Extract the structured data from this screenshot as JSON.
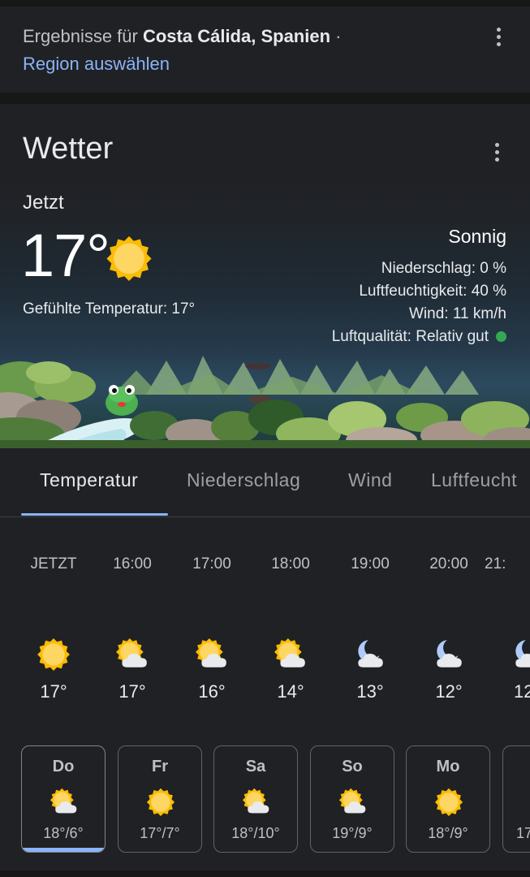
{
  "region": {
    "prefix": "Ergebnisse für ",
    "place": "Costa Cálida, Spanien",
    "suffix": " ·",
    "link": "Region auswählen"
  },
  "weather": {
    "title": "Wetter",
    "now_label": "Jetzt",
    "temperature": "17°",
    "condition": "Sonnig",
    "feels_like": "Gefühlte Temperatur: 17°",
    "precipitation": "Niederschlag: 0 %",
    "humidity": "Luftfeuchtigkeit: 40 %",
    "wind": "Wind: 11 km/h",
    "air_quality": "Luftqualität: Relativ gut",
    "air_quality_color": "#34a853"
  },
  "tabs": [
    "Temperatur",
    "Niederschlag",
    "Wind",
    "Luftfeucht"
  ],
  "hourly": [
    {
      "time": "JETZT",
      "temp": "17°",
      "icon": "sun-icon"
    },
    {
      "time": "16:00",
      "temp": "17°",
      "icon": "sun-cloud-icon"
    },
    {
      "time": "17:00",
      "temp": "16°",
      "icon": "sun-cloud-icon"
    },
    {
      "time": "18:00",
      "temp": "14°",
      "icon": "sun-cloud-icon"
    },
    {
      "time": "19:00",
      "temp": "13°",
      "icon": "moon-cloud-icon"
    },
    {
      "time": "20:00",
      "temp": "12°",
      "icon": "moon-cloud-icon"
    },
    {
      "time": "21:",
      "temp": "12",
      "icon": "moon-cloud-icon"
    }
  ],
  "daily": [
    {
      "day": "Do",
      "temps": "18°/6°",
      "icon": "sun-cloud-icon"
    },
    {
      "day": "Fr",
      "temps": "17°/7°",
      "icon": "sun-icon"
    },
    {
      "day": "Sa",
      "temps": "18°/10°",
      "icon": "sun-cloud-icon"
    },
    {
      "day": "So",
      "temps": "19°/9°",
      "icon": "sun-cloud-icon"
    },
    {
      "day": "Mo",
      "temps": "18°/9°",
      "icon": "sun-icon"
    },
    {
      "day": "",
      "temps": "17",
      "icon": ""
    }
  ],
  "colors": {
    "accent": "#8ab4f8",
    "sun": "#fdd663",
    "background": "#202124"
  }
}
